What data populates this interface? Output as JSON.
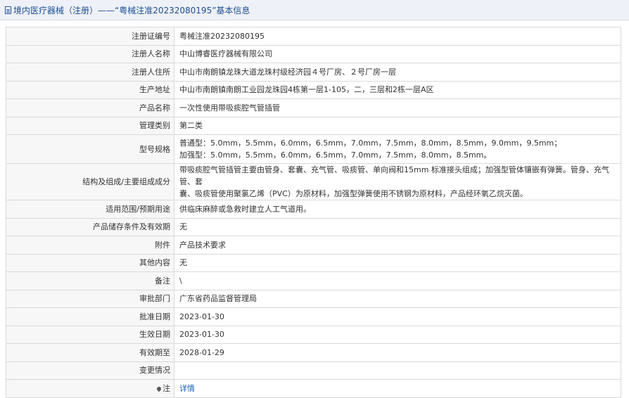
{
  "header": {
    "title": "境内医疗器械（注册）——“粤械注准20232080195”基本信息"
  },
  "rows": [
    {
      "label": "注册证编号",
      "value": "粤械注准20232080195"
    },
    {
      "label": "注册人名称",
      "value": "中山博睿医疗器械有限公司"
    },
    {
      "label": "注册人住所",
      "value": "中山市南朗镇龙珠大道龙珠村级经济园４号厂房、２号厂房一层"
    },
    {
      "label": "生产地址",
      "value": "中山市南朗镇南朗工业园龙珠园4栋第一层1-105，二，三层和2栋一层A区"
    },
    {
      "label": "产品名称",
      "value": "一次性使用带吸痰腔气管插管"
    },
    {
      "label": "管理类别",
      "value": "第二类"
    },
    {
      "label": "型号规格",
      "lines": [
        "普通型：5.0mm，5.5mm，6.0mm，6.5mm，7.0mm，7.5mm，8.0mm，8.5mm，9.0mm，9.5mm；",
        "加强型：5.0mm，5.5mm，6.0mm，6.5mm，7.0mm，7.5mm，8.0mm，8.5mm。"
      ]
    },
    {
      "label": "结构及组成/主要组成成分",
      "lines": [
        "带吸痰腔气管插管主要由管身、套囊、充气管、吸痰管、单向阀和15mm 标准接头组成；加强型管体镶嵌有弹簧。管身、充气管、套",
        "囊、吸痰管使用聚氯乙烯（PVC）为原材料，加强型弹簧使用不锈钢为原材料，产品经环氧乙烷灭菌。"
      ]
    },
    {
      "label": "适用范围/预期用途",
      "value": "供临床麻醉或急救时建立人工气道用。"
    },
    {
      "label": "产品储存条件及有效期",
      "value": "无"
    },
    {
      "label": "附件",
      "value": "产品技术要求"
    },
    {
      "label": "其他内容",
      "value": "无"
    },
    {
      "label": "备注",
      "value": "\\"
    },
    {
      "label": "审批部门",
      "value": "广东省药品监督管理局"
    },
    {
      "label": "批准日期",
      "value": "2023-01-30"
    },
    {
      "label": "生效日期",
      "value": "2023-01-30"
    },
    {
      "label": "有效期至",
      "value": "2028-01-29"
    },
    {
      "label": "变更情况",
      "value": ""
    },
    {
      "label": "注",
      "value": "详情",
      "icon": "pin-icon"
    }
  ]
}
